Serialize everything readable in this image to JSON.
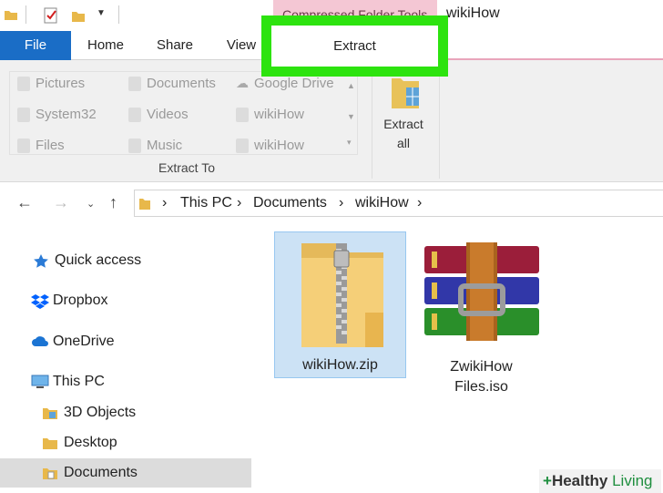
{
  "titlebar": {
    "context_tab": "Compressed Folder Tools",
    "window_title": "wikiHow"
  },
  "tabs": {
    "file": "File",
    "home": "Home",
    "share": "Share",
    "view": "View",
    "extract": "Extract"
  },
  "ribbon": {
    "gallery": [
      {
        "label": "Pictures",
        "icon": "pictures-folder-icon"
      },
      {
        "label": "Documents",
        "icon": "documents-folder-icon"
      },
      {
        "label": "Google Drive",
        "icon": "cloud-icon"
      },
      {
        "label": "System32",
        "icon": "folder-icon"
      },
      {
        "label": "Videos",
        "icon": "videos-folder-icon"
      },
      {
        "label": "wikiHow",
        "icon": "folder-icon"
      },
      {
        "label": "Files",
        "icon": "folder-icon"
      },
      {
        "label": "Music",
        "icon": "music-folder-icon"
      },
      {
        "label": "wikiHow",
        "icon": "folder-icon"
      }
    ],
    "group_label": "Extract To",
    "extract_all_line1": "Extract",
    "extract_all_line2": "all"
  },
  "address": {
    "crumbs": [
      "This PC",
      "Documents",
      "wikiHow"
    ]
  },
  "navpane": [
    {
      "label": "Quick access",
      "icon": "star-icon"
    },
    {
      "label": "Dropbox",
      "icon": "dropbox-icon"
    },
    {
      "label": "OneDrive",
      "icon": "cloud-icon"
    },
    {
      "label": "This PC",
      "icon": "computer-icon"
    },
    {
      "label": "3D Objects",
      "icon": "folder-3d-icon"
    },
    {
      "label": "Desktop",
      "icon": "folder-icon"
    },
    {
      "label": "Documents",
      "icon": "documents-folder-icon"
    }
  ],
  "files": [
    {
      "label": "wikiHow.zip",
      "icon": "zip-folder-icon",
      "selected": true
    },
    {
      "label_line1": "ZwikiHow",
      "label_line2": "Files.iso",
      "icon": "rar-archive-icon",
      "selected": false
    }
  ],
  "watermark": {
    "plus": "+",
    "healthy": "Healthy",
    "living": "Living"
  },
  "colors": {
    "file_tab": "#1a6dc6",
    "highlight": "#2de30f",
    "context_tab": "#f4c7d4"
  }
}
